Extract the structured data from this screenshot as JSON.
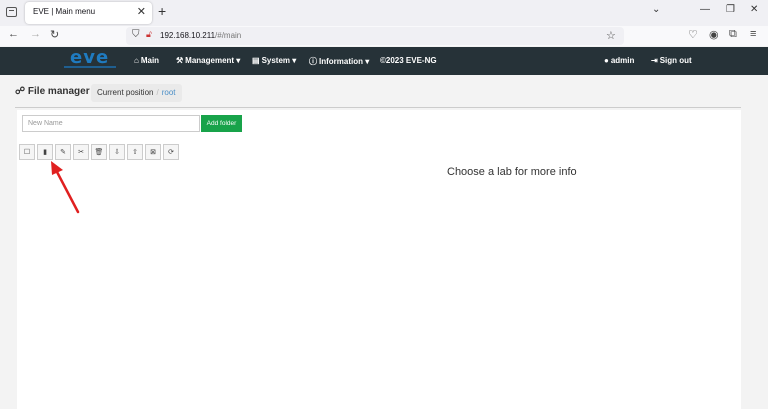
{
  "browser": {
    "tab_title": "EVE | Main menu",
    "url_host": "192.168.10.211",
    "url_path": "/#/main"
  },
  "nav": {
    "logo": "eve",
    "items": [
      {
        "label": "Main",
        "icon": "home-icon"
      },
      {
        "label": "Management",
        "icon": "wrench-icon"
      },
      {
        "label": "System",
        "icon": "hdd-icon"
      },
      {
        "label": "Information",
        "icon": "info-icon"
      },
      {
        "label": "©2023 EVE-NG",
        "icon": ""
      },
      {
        "label": "admin",
        "icon": "user-icon"
      },
      {
        "label": "Sign out",
        "icon": "sign-out-icon"
      }
    ]
  },
  "file_manager": {
    "title": "File manager",
    "breadcrumb_label": "Current position",
    "breadcrumb_root": "root",
    "name_placeholder": "New Name",
    "add_folder_label": "Add folder",
    "toolbar_icons": [
      "checkbox-icon",
      "new-file-icon",
      "pencil-icon",
      "scissors-icon",
      "trash-icon",
      "export-icon",
      "import-icon",
      "close-box-icon",
      "refresh-icon"
    ]
  },
  "main": {
    "message": "Choose a lab for more info"
  },
  "colors": {
    "topbar": "#263238",
    "accent_green": "#18a34a",
    "link_blue": "#4a8ec7",
    "arrow_red": "#e02020"
  }
}
